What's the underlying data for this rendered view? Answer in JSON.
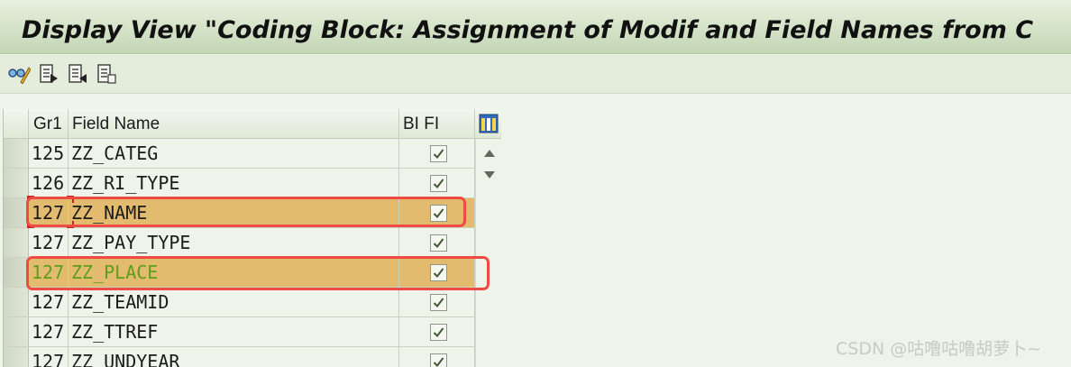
{
  "window": {
    "title": "Display View \"Coding Block: Assignment of Modif and Field Names from C"
  },
  "toolbar": {
    "buttons": [
      {
        "icon": "glasses-pencil-icon"
      },
      {
        "icon": "document-next-icon"
      },
      {
        "icon": "document-previous-icon"
      },
      {
        "icon": "document-copy-icon"
      }
    ]
  },
  "table": {
    "columns": {
      "group": "Gr1",
      "field_name": "Field Name",
      "bi_fi": "BI FI"
    },
    "rows": [
      {
        "group": "125",
        "field_name": "ZZ_CATEG",
        "bi_fi": true
      },
      {
        "group": "126",
        "field_name": "ZZ_RI_TYPE",
        "bi_fi": true
      },
      {
        "group": "127",
        "field_name": "ZZ_NAME",
        "bi_fi": true
      },
      {
        "group": "127",
        "field_name": "ZZ_PAY_TYPE",
        "bi_fi": true
      },
      {
        "group": "127",
        "field_name": "ZZ_PLACE",
        "bi_fi": true
      },
      {
        "group": "127",
        "field_name": "ZZ_TEAMID",
        "bi_fi": true
      },
      {
        "group": "127",
        "field_name": "ZZ_TTREF",
        "bi_fi": true
      },
      {
        "group": "127",
        "field_name": "ZZ_UNDYEAR",
        "bi_fi": true
      }
    ]
  },
  "colors": {
    "highlight_row": "#e3bb6f",
    "annotation_red": "#ef4b45",
    "highlight_text_green": "#5d9d1c"
  },
  "watermark": "CSDN @咕噜咕噜胡萝卜~"
}
